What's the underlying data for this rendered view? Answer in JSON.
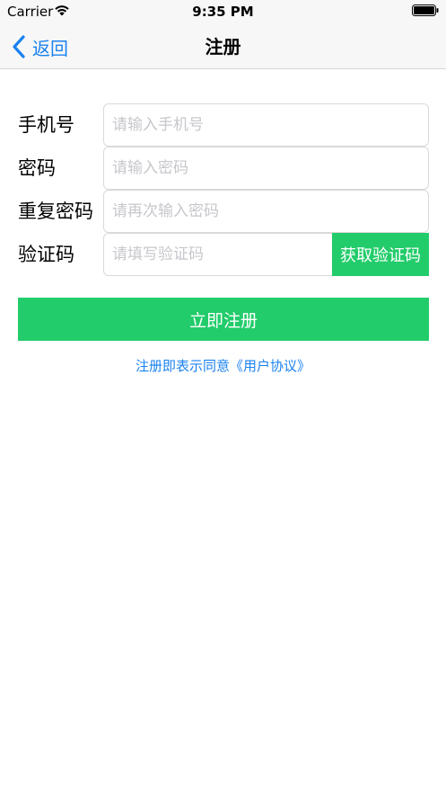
{
  "status_bar": {
    "carrier": "Carrier",
    "time": "9:35 PM",
    "wifi_icon": "wifi-icon",
    "battery_icon": "battery-full-icon"
  },
  "nav": {
    "back_label": "返回",
    "back_icon": "chevron-left-icon",
    "title": "注册"
  },
  "form": {
    "phone": {
      "label": "手机号",
      "placeholder": "请输入手机号",
      "value": ""
    },
    "password": {
      "label": "密码",
      "placeholder": "请输入密码",
      "value": ""
    },
    "confirm_password": {
      "label": "重复密码",
      "placeholder": "请再次输入密码",
      "value": ""
    },
    "code": {
      "label": "验证码",
      "placeholder": "请填写验证码",
      "value": "",
      "button_label": "获取验证码"
    }
  },
  "register_button": "立即注册",
  "agreement_text": "注册即表示同意《用户协议》",
  "colors": {
    "accent_green": "#22cc6a",
    "link_blue": "#1a82f0",
    "placeholder_gray": "#c7c7cc"
  }
}
